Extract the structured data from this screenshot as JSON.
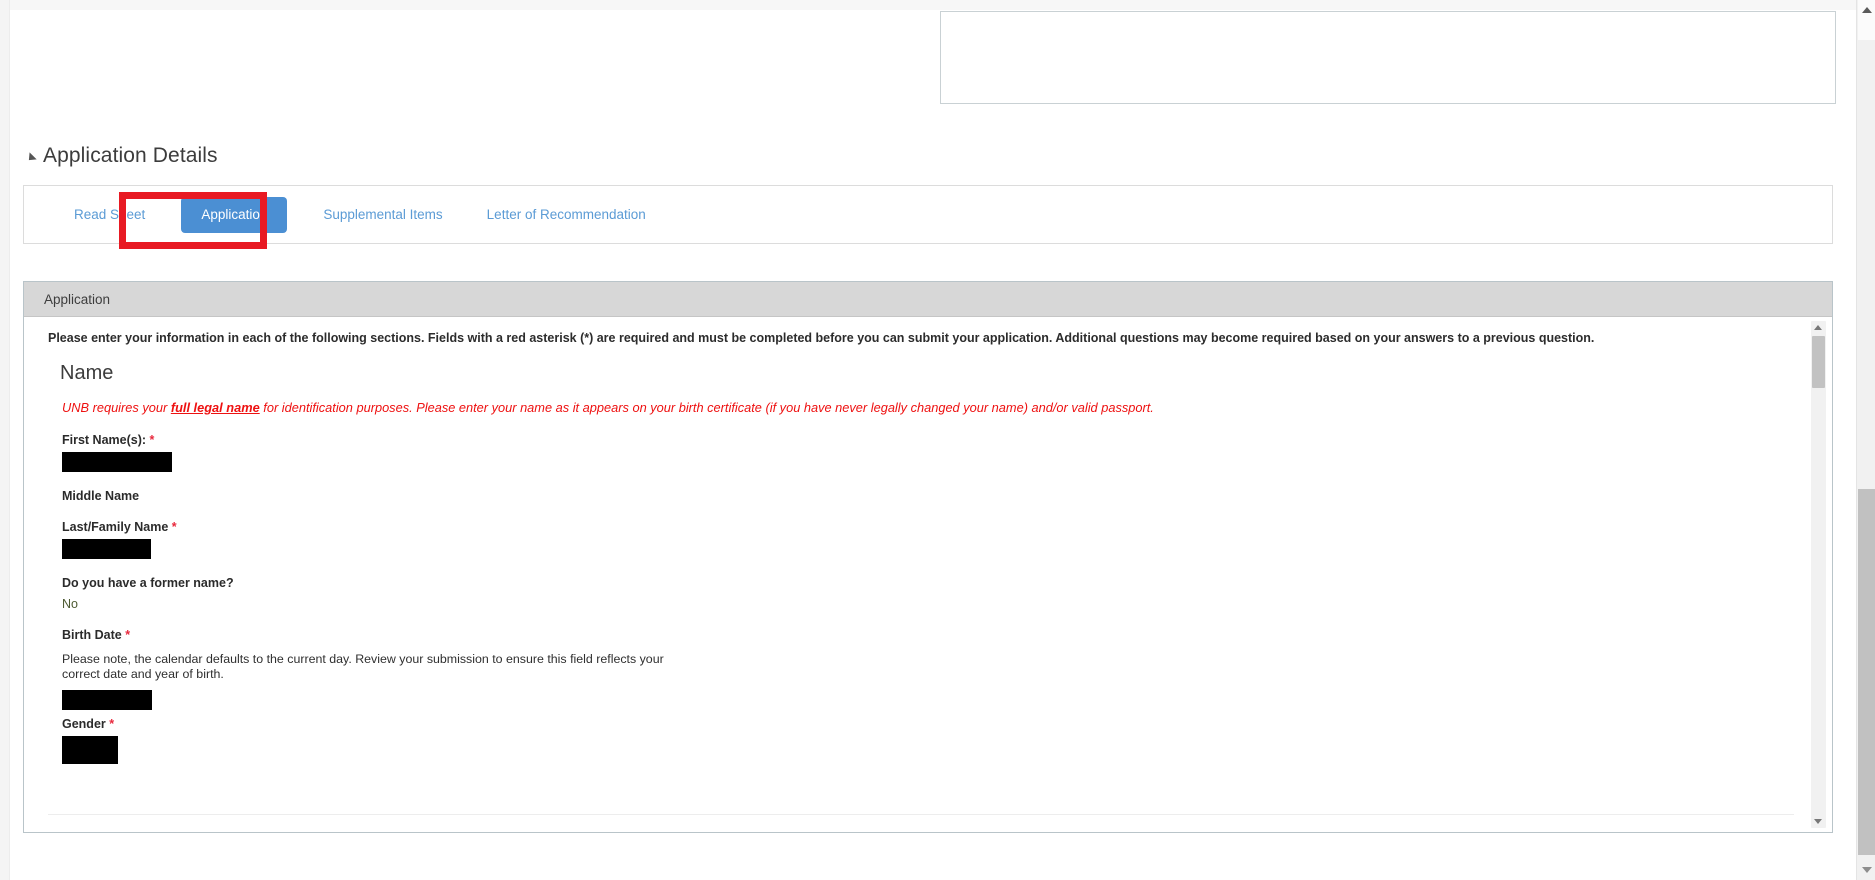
{
  "page": {
    "section_title": "Application Details"
  },
  "tabs": [
    {
      "label": "Read Sheet",
      "active": false
    },
    {
      "label": "Application",
      "active": true
    },
    {
      "label": "Supplemental Items",
      "active": false
    },
    {
      "label": "Letter of Recommendation",
      "active": false
    }
  ],
  "panel": {
    "header_title": "Application",
    "intro": "Please enter your information in each of the following sections. Fields with a red asterisk (*) are required and must be completed before you can submit your application. Additional questions may become required based on your answers to a previous question.",
    "name_heading": "Name",
    "legal_note_pre": "UNB requires your ",
    "legal_note_bold": "full legal name",
    "legal_note_post": " for identification purposes. Please enter your name as it appears on your birth certificate (if you have never legally changed your name) and/or valid passport."
  },
  "fields": {
    "first_name_label": "First Name(s):",
    "first_name_required": "*",
    "first_name_value": "",
    "middle_name_label": "Middle Name",
    "last_name_label": "Last/Family Name",
    "last_name_required": "*",
    "last_name_value": "",
    "former_name_label": "Do you have a former name?",
    "former_name_value": "No",
    "birth_date_label": "Birth Date",
    "birth_date_required": "*",
    "birth_date_helper": "Please note, the calendar defaults to the current day. Review your submission to ensure this field reflects your correct date and year of birth.",
    "birth_date_value": "",
    "gender_label": "Gender",
    "gender_required": "*",
    "gender_value": ""
  },
  "colors": {
    "tab_active_bg": "#4b8fd3",
    "tab_link": "#5b9bd5",
    "annotation": "#e81a23",
    "required_asterisk": "#e8283c",
    "legal_note": "#ee1111",
    "panel_header_bg": "#d7d7d7"
  }
}
